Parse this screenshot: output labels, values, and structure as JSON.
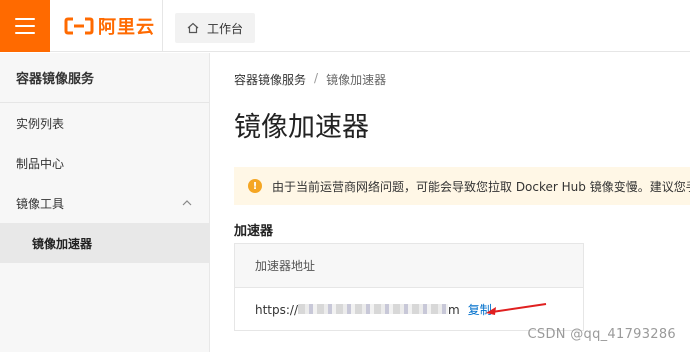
{
  "header": {
    "logo_text": "阿里云",
    "workbench_label": "工作台"
  },
  "sidebar": {
    "title": "容器镜像服务",
    "items": [
      {
        "label": "实例列表"
      },
      {
        "label": "制品中心"
      },
      {
        "label": "镜像工具",
        "expanded": true
      },
      {
        "label": "镜像加速器",
        "active": true
      }
    ]
  },
  "breadcrumb": {
    "items": [
      "容器镜像服务",
      "镜像加速器"
    ],
    "separator": "/"
  },
  "page": {
    "title": "镜像加速器",
    "notice": "由于当前运营商网络问题，可能会导致您拉取 Docker Hub 镜像变慢。建议您手",
    "section_label": "加速器",
    "table": {
      "header": "加速器地址",
      "url_prefix": "https://",
      "url_suffix": "m",
      "copy_label": "复制"
    }
  },
  "watermark": "CSDN @qq_41793286",
  "colors": {
    "brand": "#ff6a00",
    "link": "#0070cc",
    "notice_bg": "#fff7e6",
    "warn": "#f5a623",
    "arrow": "#e02020"
  }
}
